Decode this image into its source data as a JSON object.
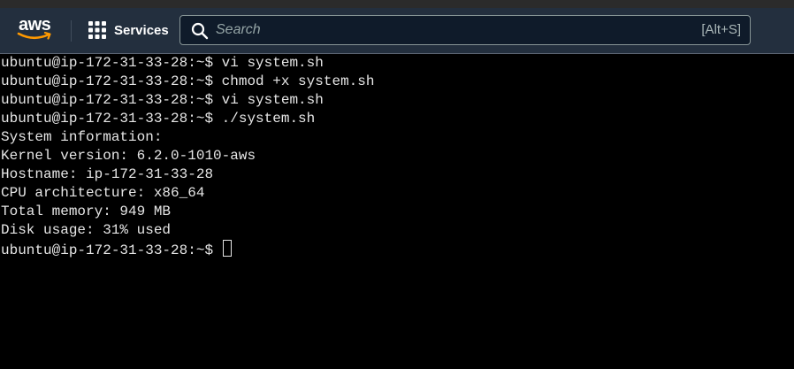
{
  "navbar": {
    "logo_text": "aws",
    "services_label": "Services",
    "search": {
      "placeholder": "Search",
      "value": "",
      "shortcut": "[Alt+S]"
    }
  },
  "terminal": {
    "prompt": "ubuntu@ip-172-31-33-28:~$",
    "lines": [
      "ubuntu@ip-172-31-33-28:~$ vi system.sh",
      "ubuntu@ip-172-31-33-28:~$ chmod +x system.sh",
      "ubuntu@ip-172-31-33-28:~$ vi system.sh",
      "ubuntu@ip-172-31-33-28:~$ ./system.sh",
      "System information:",
      "Kernel version: 6.2.0-1010-aws",
      "Hostname: ip-172-31-33-28",
      "CPU architecture: x86_64",
      "Total memory: 949 MB",
      "Disk usage: 31% used"
    ],
    "current_line": "ubuntu@ip-172-31-33-28:~$ "
  },
  "colors": {
    "navbar_bg": "#232f3e",
    "terminal_bg": "#000000",
    "terminal_fg": "#e6e6e6",
    "aws_smile": "#ff9900"
  }
}
